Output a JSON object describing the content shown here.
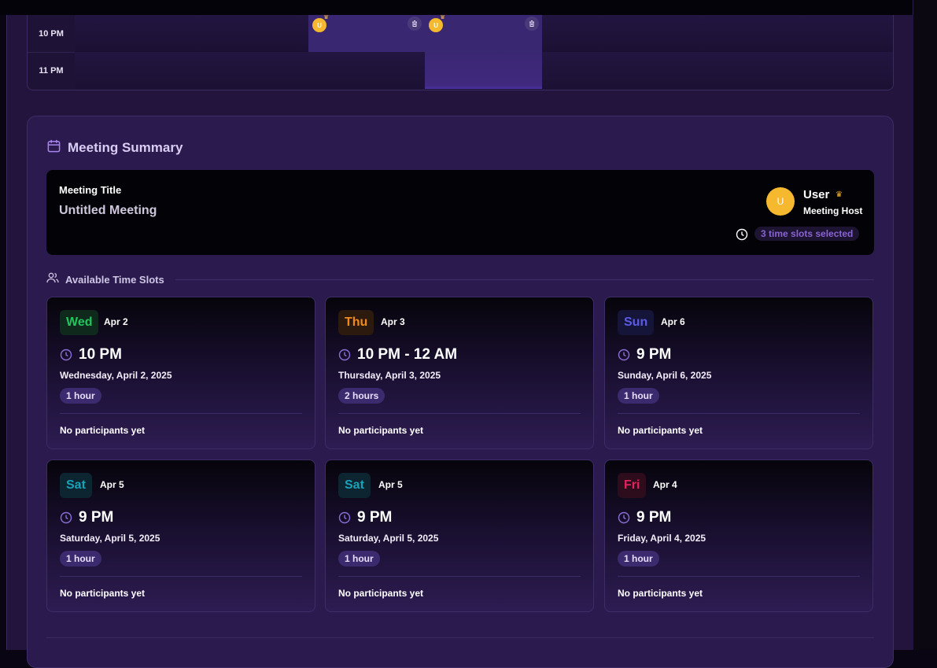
{
  "calendar": {
    "rows": [
      {
        "time": "10 PM"
      },
      {
        "time": "11 PM"
      }
    ],
    "events": [
      {
        "avatar_initial": "U",
        "crown": "♛"
      },
      {
        "avatar_initial": "U",
        "crown": "♛"
      }
    ]
  },
  "summary": {
    "title": "Meeting Summary",
    "meeting_title_label": "Meeting Title",
    "meeting_title_value": "Untitled Meeting",
    "host": {
      "initial": "U",
      "name": "User",
      "crown": "♛",
      "role": "Meeting Host"
    },
    "slots_badge": "3 time slots selected",
    "available_title": "Available Time Slots",
    "slots": [
      {
        "day": "Wed",
        "date_short": "Apr 2",
        "time": "10 PM",
        "full_date": "Wednesday, April 2, 2025",
        "duration": "1 hour",
        "participants": "No participants yet",
        "day_color": "#22c55e",
        "day_bg": "#0f2a1c"
      },
      {
        "day": "Thu",
        "date_short": "Apr 3",
        "time": "10 PM - 12 AM",
        "full_date": "Thursday, April 3, 2025",
        "duration": "2 hours",
        "participants": "No participants yet",
        "day_color": "#f08a1c",
        "day_bg": "#2d1a0e"
      },
      {
        "day": "Sun",
        "date_short": "Apr 6",
        "time": "9 PM",
        "full_date": "Sunday, April 6, 2025",
        "duration": "1 hour",
        "participants": "No participants yet",
        "day_color": "#5b5be6",
        "day_bg": "#15153a"
      },
      {
        "day": "Sat",
        "date_short": "Apr 5",
        "time": "9 PM",
        "full_date": "Saturday, April 5, 2025",
        "duration": "1 hour",
        "participants": "No participants yet",
        "day_color": "#17a2b8",
        "day_bg": "#0c2530"
      },
      {
        "day": "Sat",
        "date_short": "Apr 5",
        "time": "9 PM",
        "full_date": "Saturday, April 5, 2025",
        "duration": "1 hour",
        "participants": "No participants yet",
        "day_color": "#17a2b8",
        "day_bg": "#0c2530"
      },
      {
        "day": "Fri",
        "date_short": "Apr 4",
        "time": "9 PM",
        "full_date": "Friday, April 4, 2025",
        "duration": "1 hour",
        "participants": "No participants yet",
        "day_color": "#e0245e",
        "day_bg": "#2d0c1c"
      }
    ]
  },
  "colors": {
    "accent": "#8a63d2",
    "avatar": "#f5b82e",
    "panel": "#2b1a4d",
    "selected_cell": "#3a2772"
  }
}
